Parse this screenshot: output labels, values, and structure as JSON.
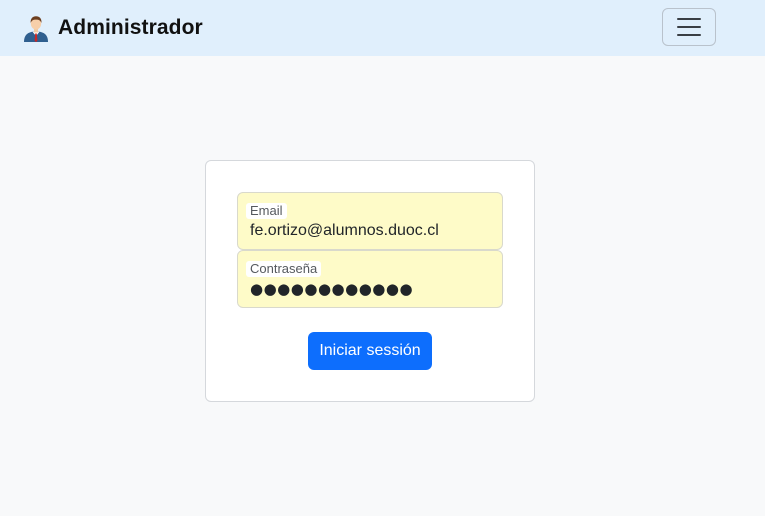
{
  "navbar": {
    "brand_icon": "businessman-avatar-icon",
    "brand_text": "Administrador",
    "toggle_icon": "hamburger-menu-icon",
    "background": "#e0effc"
  },
  "login": {
    "email_label": "Email",
    "email_value": "fe.ortizo@alumnos.duoc.cl",
    "password_label": "Contraseña",
    "password_display": "●●●●●●●●●●●●",
    "submit_label": "Iniciar sessión",
    "field_background": "#fefbc8",
    "submit_color": "#0d6efd"
  }
}
